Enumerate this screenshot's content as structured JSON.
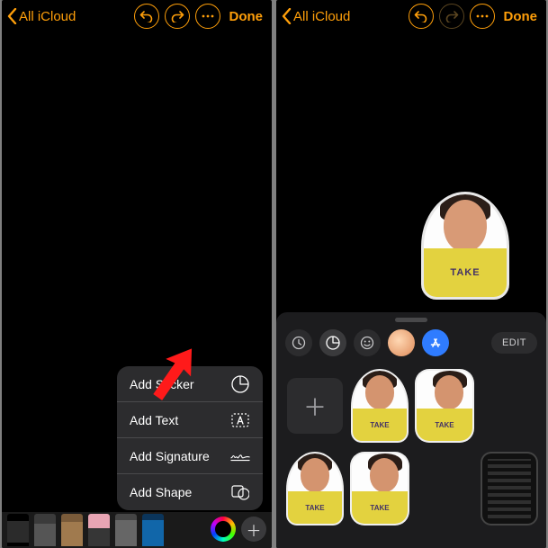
{
  "accent": "#FF9F0A",
  "left": {
    "nav": {
      "back_label": "All iCloud",
      "done": "Done"
    },
    "menu": {
      "items": [
        {
          "label": "Add Sticker",
          "icon": "sticker-icon"
        },
        {
          "label": "Add Text",
          "icon": "text-box-icon"
        },
        {
          "label": "Add Signature",
          "icon": "signature-icon"
        },
        {
          "label": "Add Shape",
          "icon": "shape-icon"
        }
      ]
    },
    "tools": [
      {
        "name": "pen-tool"
      },
      {
        "name": "marker-tool"
      },
      {
        "name": "pencil-tool"
      },
      {
        "name": "eraser-tool"
      },
      {
        "name": "lasso-tool"
      },
      {
        "name": "ruler-tool"
      }
    ]
  },
  "right": {
    "nav": {
      "back_label": "All iCloud",
      "done": "Done"
    },
    "drawer": {
      "edit": "EDIT",
      "tabs": [
        {
          "name": "recents",
          "icon": "clock-icon"
        },
        {
          "name": "stickers",
          "icon": "sticker-icon",
          "active": true
        },
        {
          "name": "emoji",
          "icon": "emoji-icon"
        },
        {
          "name": "memoji",
          "icon": "memoji-avatar"
        },
        {
          "name": "apps",
          "icon": "appstore-icon"
        }
      ],
      "shirt_text": "TAKE"
    }
  }
}
